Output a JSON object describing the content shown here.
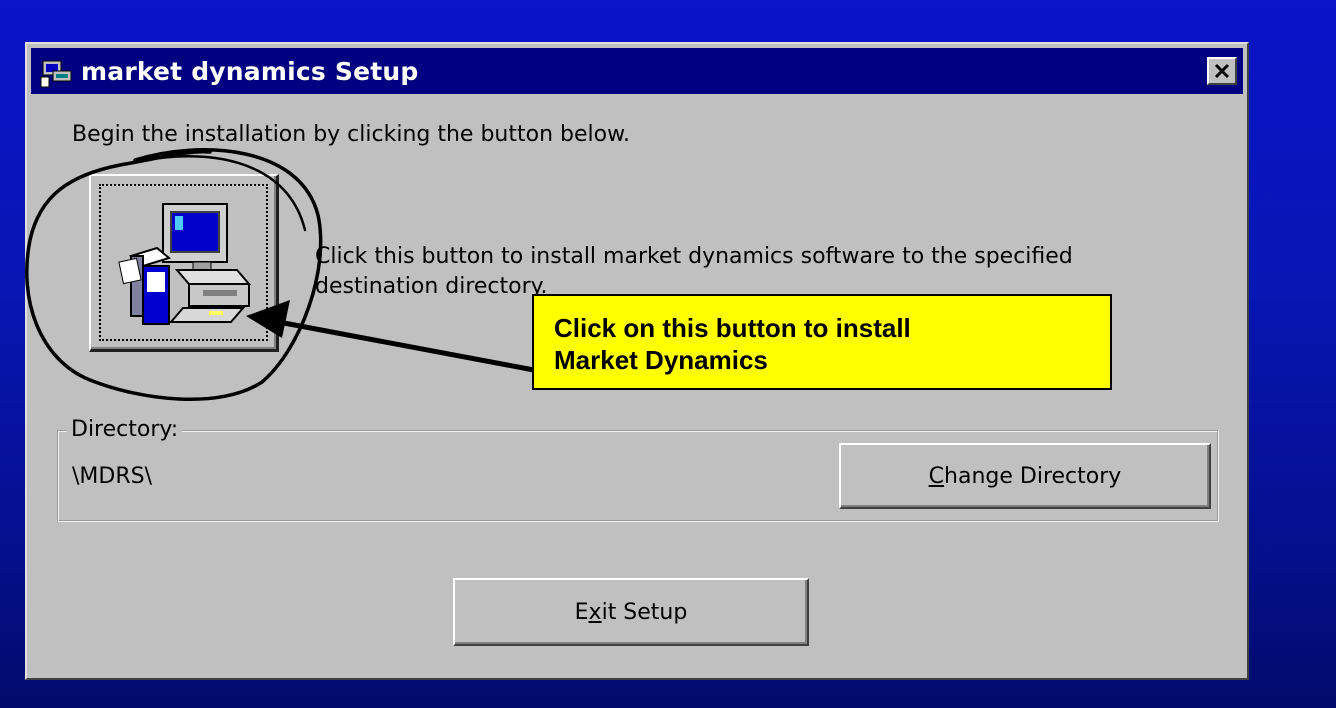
{
  "dialog": {
    "title": "market dynamics Setup",
    "intro_text": "Begin the installation by clicking the button below.",
    "install_description_line1": "Click this button to install market dynamics software to the specified",
    "install_description_line2": "destination directory.",
    "directory_group_label": "Directory:",
    "directory_value": "\\MDRS\\",
    "change_directory_label_pre": "",
    "change_directory_accel": "C",
    "change_directory_label_post": "hange Directory",
    "exit_label_pre": "E",
    "exit_accel": "x",
    "exit_label_post": "it Setup"
  },
  "callout": {
    "line1": "Click on this button to install",
    "line2": "Market Dynamics"
  },
  "colors": {
    "background": "#0816b4",
    "titlebar": "#000080",
    "dialog_face": "#c0c0c0",
    "callout_fill": "#ffff00"
  },
  "icons": [
    "setup-app-icon",
    "close-icon",
    "computer-install-icon"
  ]
}
